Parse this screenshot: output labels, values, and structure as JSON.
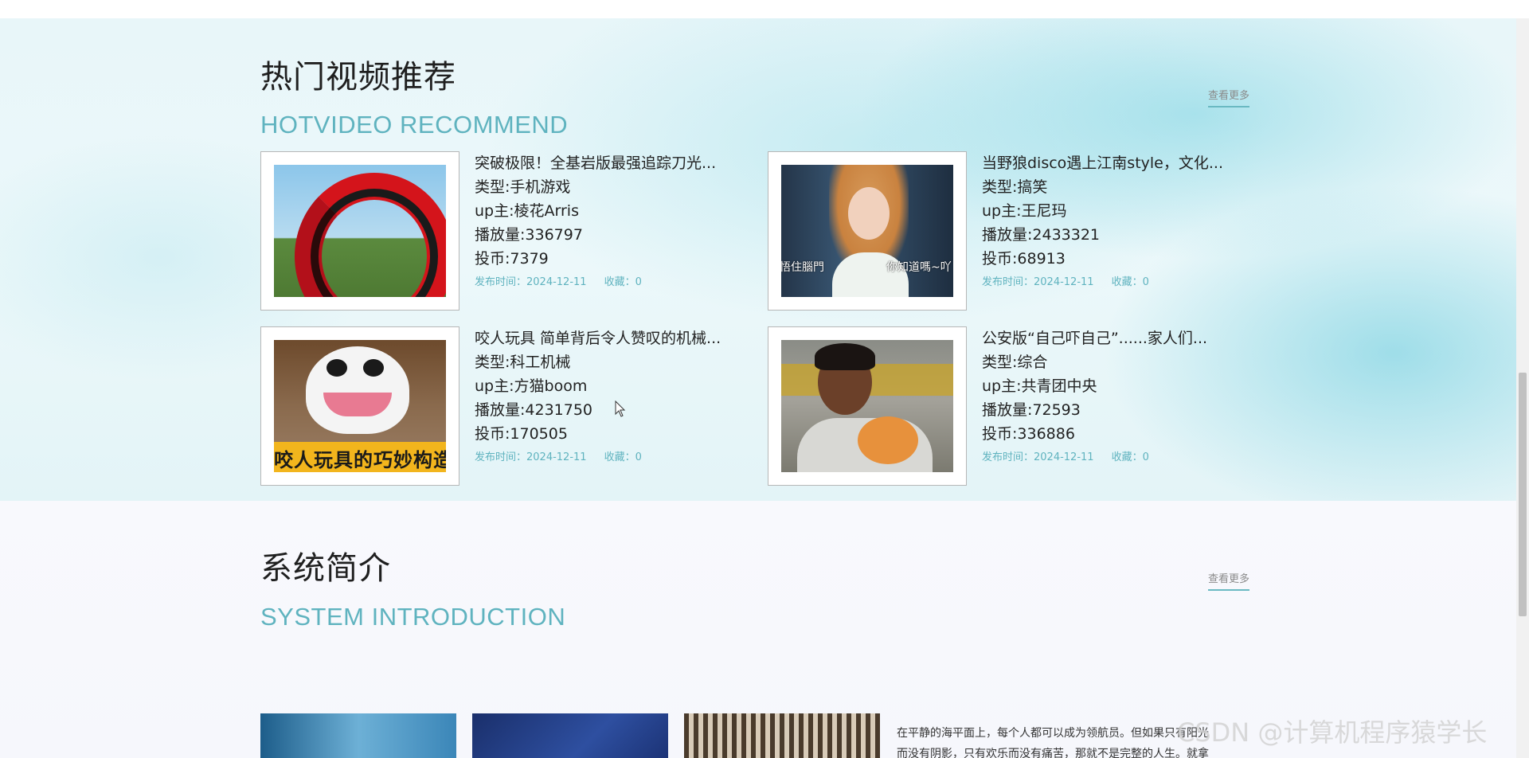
{
  "hot_section": {
    "title": "热门视频推荐",
    "subtitle": "HOTVIDEO RECOMMEND",
    "more": "查看更多"
  },
  "videos": [
    {
      "title": "突破极限！全基岩版最强追踪刀光...",
      "type": "类型:手机游戏",
      "uploader": "up主:棱花Arris",
      "plays": "播放量:336797",
      "coins": "投币:7379",
      "publish": "发布时间：2024-12-11",
      "favorites": "收藏：0"
    },
    {
      "title": "当野狼disco遇上江南style，文化...",
      "type": "类型:搞笑",
      "uploader": "up主:王尼玛",
      "plays": "播放量:2433321",
      "coins": "投币:68913",
      "publish": "发布时间：2024-12-11",
      "favorites": "收藏：0",
      "thumb_caption_left": "悟住腦門",
      "thumb_caption_right": "你知道嗎~吖"
    },
    {
      "title": "咬人玩具 简单背后令人赞叹的机械...",
      "type": "类型:科工机械",
      "uploader": "up主:方猫boom",
      "plays": "播放量:4231750",
      "coins": "投币:170505",
      "publish": "发布时间：2024-12-11",
      "favorites": "收藏：0",
      "thumb_caption": "咬人玩具的巧妙构造"
    },
    {
      "title": "公安版“自己吓自己”......家人们...",
      "type": "类型:综合",
      "uploader": "up主:共青团中央",
      "plays": "播放量:72593",
      "coins": "投币:336886",
      "publish": "发布时间：2024-12-11",
      "favorites": "收藏：0"
    }
  ],
  "intro_section": {
    "title": "系统简介",
    "subtitle": "SYSTEM INTRODUCTION",
    "more": "查看更多",
    "text_line1": "在平静的海平面上，每个人都可以成为领航员。但如果只有阳光",
    "text_line2": "而没有阴影，只有欢乐而没有痛苦，那就不是完整的人生。就拿"
  },
  "watermark": "CSDN @计算机程序猿学长",
  "colors": {
    "accent": "#5fb3bf",
    "meta": "#5fb3bf",
    "title_text": "#1f1f1f"
  }
}
